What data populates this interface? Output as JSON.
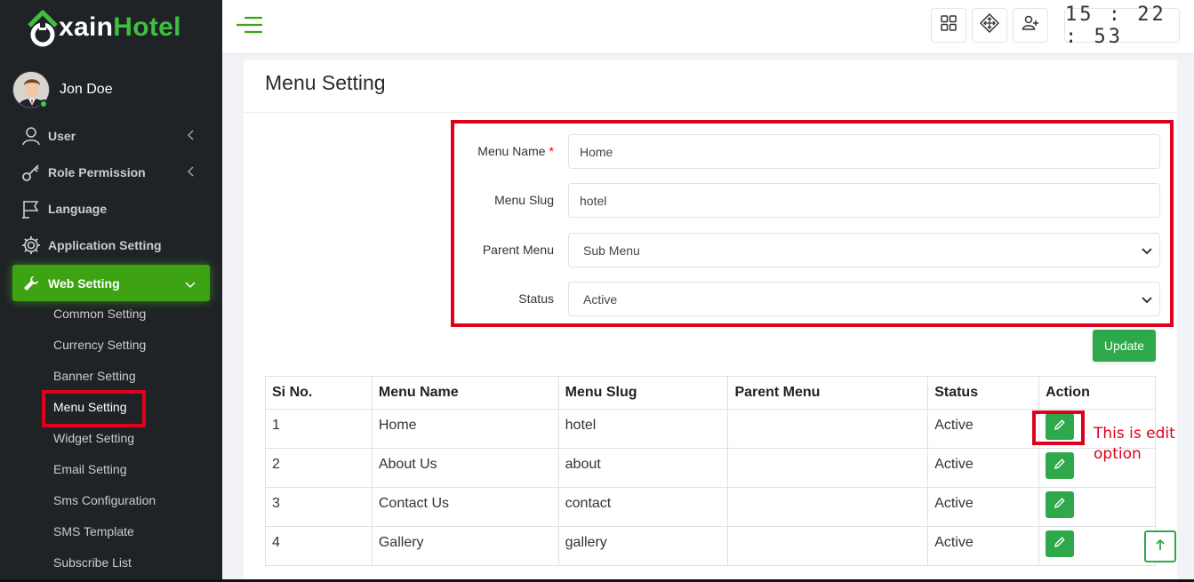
{
  "brand": {
    "logo_letter_prefix": "xain",
    "logo_word_accent": "Hotel"
  },
  "user": {
    "name": "Jon Doe"
  },
  "sidebar": {
    "items": [
      {
        "label": "User",
        "icon": "user-icon"
      },
      {
        "label": "Role Permission",
        "icon": "key-icon"
      },
      {
        "label": "Language",
        "icon": "flag-icon"
      },
      {
        "label": "Application Setting",
        "icon": "gear-icon"
      },
      {
        "label": "Web Setting",
        "icon": "wrench-icon"
      }
    ],
    "sub_items": [
      "Common Setting",
      "Currency Setting",
      "Banner Setting",
      "Menu Setting",
      "Widget Setting",
      "Email Setting",
      "Sms Configuration",
      "SMS Template",
      "Subscribe List"
    ]
  },
  "topbar": {
    "clock": "15:22:53"
  },
  "page": {
    "title": "Menu Setting"
  },
  "form": {
    "menu_name_label": "Menu Name",
    "required_mark": "*",
    "menu_name_value": "Home",
    "menu_slug_label": "Menu Slug",
    "menu_slug_value": "hotel",
    "parent_menu_label": "Parent Menu",
    "parent_menu_value": "Sub Menu",
    "status_label": "Status",
    "status_value": "Active",
    "update_label": "Update"
  },
  "table": {
    "headers": [
      "Si No.",
      "Menu Name",
      "Menu Slug",
      "Parent Menu",
      "Status",
      "Action"
    ],
    "rows": [
      {
        "no": "1",
        "name": "Home",
        "slug": "hotel",
        "parent": "",
        "status": "Active"
      },
      {
        "no": "2",
        "name": "About Us",
        "slug": "about",
        "parent": "",
        "status": "Active"
      },
      {
        "no": "3",
        "name": "Contact Us",
        "slug": "contact",
        "parent": "",
        "status": "Active"
      },
      {
        "no": "4",
        "name": "Gallery",
        "slug": "gallery",
        "parent": "",
        "status": "Active"
      }
    ]
  },
  "annotation": {
    "line1": "This is edit",
    "line2": "option"
  },
  "colors": {
    "brand_green": "#3ea312",
    "button_green": "#2ea84a",
    "highlight_red": "#e1001c",
    "sidebar_bg": "#1f2326"
  }
}
